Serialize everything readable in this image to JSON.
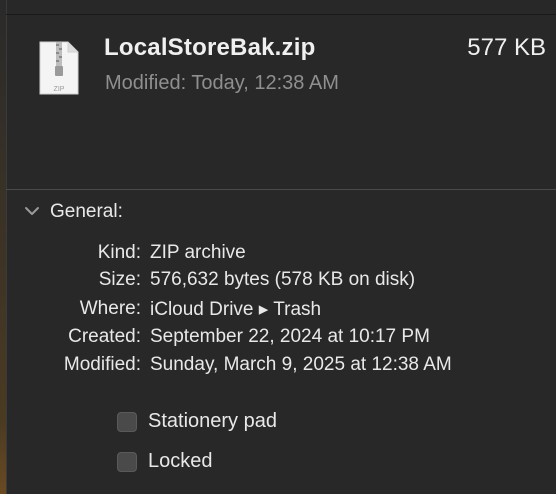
{
  "file": {
    "name": "LocalStoreBak.zip",
    "size": "577 KB",
    "modified": "Modified: Today, 12:38 AM",
    "icon_label": "ZIP",
    "icon": "zip-file-icon"
  },
  "general": {
    "title": "General:",
    "rows": [
      {
        "label": "Kind:",
        "value": "ZIP archive"
      },
      {
        "label": "Size:",
        "value": "576,632 bytes (578 KB on disk)"
      },
      {
        "label": "Where:",
        "value": "iCloud Drive ▸ Trash"
      },
      {
        "label": "Created:",
        "value": "September 22, 2024 at 10:17 PM"
      },
      {
        "label": "Modified:",
        "value": "Sunday, March 9, 2025 at 12:38 AM"
      }
    ],
    "checkboxes": [
      {
        "label": "Stationery pad",
        "checked": false
      },
      {
        "label": "Locked",
        "checked": false
      }
    ]
  }
}
